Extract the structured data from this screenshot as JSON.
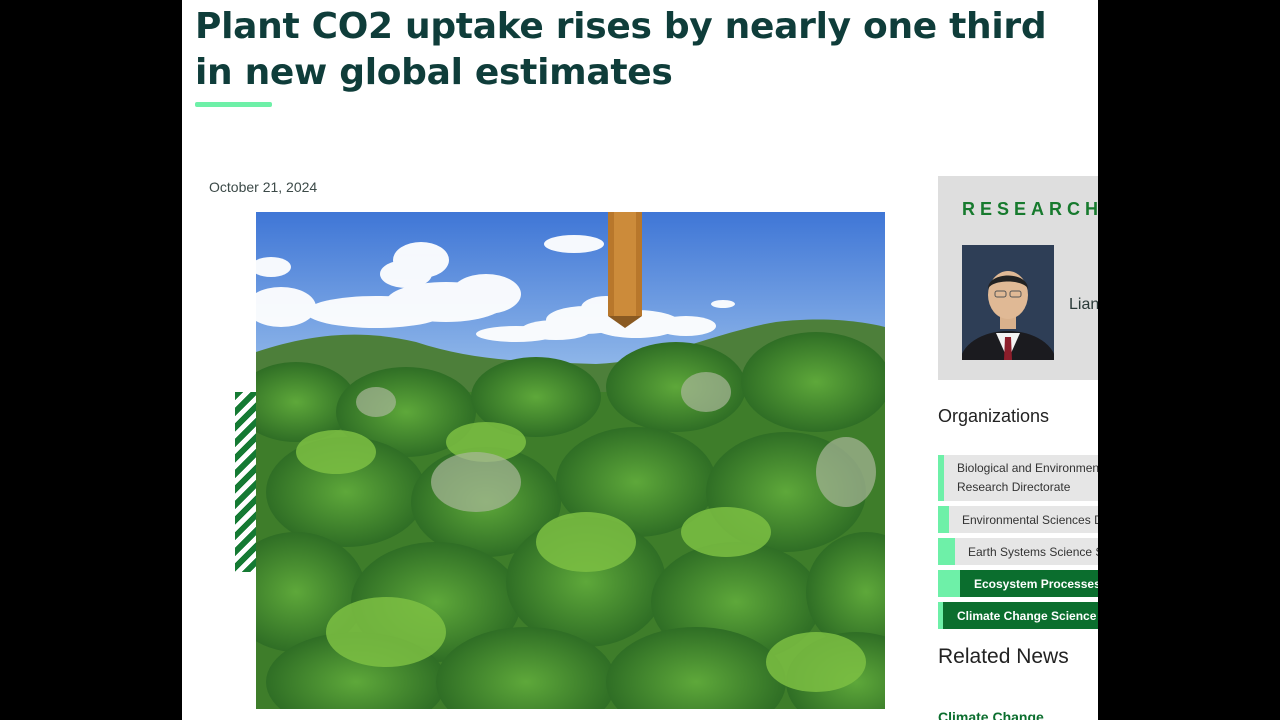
{
  "article": {
    "title": "Plant CO2 uptake rises by nearly one third in new global estimates",
    "date": "October 21, 2024"
  },
  "sidebar": {
    "researcher_heading": "RESEARCHER",
    "researcher_name": "Liang",
    "organizations_heading": "Organizations",
    "organizations": [
      {
        "label": "Biological and Environmental Research Directorate"
      },
      {
        "label": "Environmental Sciences Division"
      },
      {
        "label": "Earth Systems Science Section"
      },
      {
        "label": "Ecosystem Processes Group"
      },
      {
        "label": "Climate Change Science Institute"
      }
    ],
    "related_heading": "Related News",
    "related_link": "Climate Change"
  },
  "colors": {
    "title": "#0f3d3a",
    "accent_green": "#6ef0a8",
    "dark_green": "#0b6e2e",
    "card_gray": "#dedede"
  }
}
